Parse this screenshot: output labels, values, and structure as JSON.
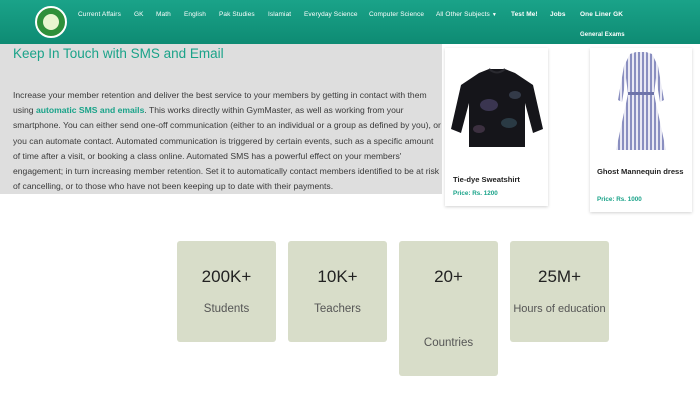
{
  "nav": {
    "items": [
      "Current Affairs",
      "GK",
      "Math",
      "English",
      "Pak Studies",
      "Islamiat",
      "Everyday Science",
      "Computer Science",
      "All Other Subjects"
    ],
    "test_me": "Test Me!",
    "jobs": "Jobs",
    "one_liner": "One Liner GK",
    "general_exams": "General Exams",
    "logo_icon": "school-logo-icon"
  },
  "main": {
    "heading": "Keep In Touch with SMS and Email",
    "para_before": "Increase your member retention and deliver the best service to your members by getting in contact with them using ",
    "para_link": "automatic SMS and emails",
    "para_after": ". This works directly within GymMaster, as well as working from your smartphone. You can either send one-off communication (either to an individual or a group as defined by you), or you can automate contact. Automated communication is triggered by certain events, such as a specific amount of time after a visit, or booking a class online. Automated SMS has a powerful effect on your members' engagement; in turn increasing member retention. Set it to automatically contact members identified to be at risk of cancelling, or to those who have not been keeping up to date with their payments."
  },
  "products": [
    {
      "name": "Tie-dye Sweatshirt",
      "price": "Price: Rs. 1200",
      "icon": "sweatshirt-image"
    },
    {
      "name": "Ghost Mannequin dress",
      "price": "Price: Rs. 1000",
      "icon": "dress-image"
    }
  ],
  "stats": [
    {
      "value": "200K+",
      "label": "Students"
    },
    {
      "value": "10K+",
      "label": "Teachers"
    },
    {
      "value": "20+",
      "label": "Countries"
    },
    {
      "value": "25M+",
      "label": "Hours of education"
    }
  ],
  "colors": {
    "accent": "#1aa389",
    "stat_bg": "#d8ddc9",
    "panel_bg": "#dedede"
  }
}
